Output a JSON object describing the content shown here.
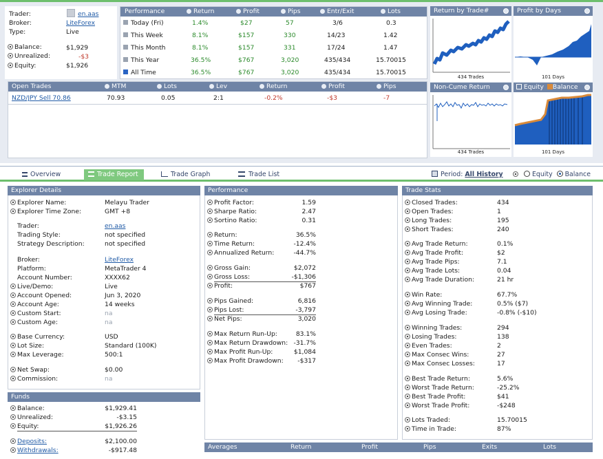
{
  "account": {
    "trader_label": "Trader:",
    "trader": "en.aas",
    "broker_label": "Broker:",
    "broker": "LiteForex",
    "type_label": "Type:",
    "type": "Live",
    "balance_label": "Balance:",
    "balance": "$1,929",
    "unrealized_label": "Unrealized:",
    "unrealized": "-$3",
    "equity_label": "Equity:",
    "equity": "$1,926"
  },
  "performance_table": {
    "headers": [
      "Performance",
      "Return",
      "Profit",
      "Pips",
      "Entr/Exit",
      "Lots"
    ],
    "rows": [
      {
        "period": "Today (Fri)",
        "return": "1.4%",
        "profit": "$27",
        "pips": "57",
        "entr_exit": "3/6",
        "lots": "0.3"
      },
      {
        "period": "This Week",
        "return": "8.1%",
        "profit": "$157",
        "pips": "330",
        "entr_exit": "14/23",
        "lots": "1.42"
      },
      {
        "period": "This Month",
        "return": "8.1%",
        "profit": "$157",
        "pips": "331",
        "entr_exit": "17/24",
        "lots": "1.47"
      },
      {
        "period": "This Year",
        "return": "36.5%",
        "profit": "$767",
        "pips": "3,020",
        "entr_exit": "435/434",
        "lots": "15.70015"
      },
      {
        "period": "All Time",
        "return": "36.5%",
        "profit": "$767",
        "pips": "3,020",
        "entr_exit": "435/434",
        "lots": "15.70015"
      }
    ]
  },
  "open_trades": {
    "headers": [
      "Open Trades",
      "MTM",
      "Lots",
      "Lev",
      "Return",
      "Profit",
      "Pips"
    ],
    "rows": [
      {
        "trade": "NZD/JPY Sell 70.86",
        "mtm": "70.93",
        "lots": "0.05",
        "lev": "2:1",
        "return": "-0.2%",
        "profit": "-$3",
        "pips": "-7"
      }
    ]
  },
  "mini_charts": {
    "return_by_trade": {
      "title": "Return by Trade#",
      "caption": "434 Trades"
    },
    "profit_by_days": {
      "title": "Profit by Days",
      "caption": "101 Days"
    },
    "non_cume_return": {
      "title": "Non-Cume Return",
      "caption": "434 Trades"
    },
    "equity_balance": {
      "equity_label": "Equity",
      "balance_label": "Balance",
      "caption": "101 Days"
    }
  },
  "tabs": {
    "overview": "Overview",
    "trade_report": "Trade Report",
    "trade_graph": "Trade Graph",
    "trade_list": "Trade List",
    "period_label": "Period:",
    "period_value": "All History",
    "equity": "Equity",
    "balance": "Balance"
  },
  "explorer": {
    "title": "Explorer Details",
    "items": [
      {
        "label": "Explorer Name:",
        "value": "Melayu Trader"
      },
      {
        "label": "Explorer Time Zone:",
        "value": "GMT +8"
      },
      {
        "label": "Trader:",
        "value": "en.aas"
      },
      {
        "label": "Trading Style:",
        "value": "not specified"
      },
      {
        "label": "Strategy Description:",
        "value": "not specified"
      },
      {
        "label": "Broker:",
        "value": "LiteForex"
      },
      {
        "label": "Platform:",
        "value": "MetaTrader 4"
      },
      {
        "label": "Account Number:",
        "value": "XXXX62"
      },
      {
        "label": "Live/Demo:",
        "value": "Live"
      },
      {
        "label": "Account Opened:",
        "value": "Jun 3, 2020"
      },
      {
        "label": "Account Age:",
        "value": "14 weeks"
      },
      {
        "label": "Custom Start:",
        "value": "na"
      },
      {
        "label": "Custom Age:",
        "value": "na"
      },
      {
        "label": "Base Currency:",
        "value": "USD"
      },
      {
        "label": "Lot Size:",
        "value": "Standard (100K)"
      },
      {
        "label": "Max Leverage:",
        "value": "500:1"
      },
      {
        "label": "Net Swap:",
        "value": "$0.00"
      },
      {
        "label": "Commission:",
        "value": "na"
      }
    ]
  },
  "funds": {
    "title": "Funds",
    "items": [
      {
        "label": "Balance:",
        "value": "$1,929.41"
      },
      {
        "label": "Unrealized:",
        "value": "-$3.15"
      },
      {
        "label": "Equity:",
        "value": "$1,926.26"
      },
      {
        "label": "Deposits:",
        "value": "$2,100.00"
      },
      {
        "label": "Withdrawals:",
        "value": "-$917.48"
      }
    ]
  },
  "performance": {
    "title": "Performance",
    "items": [
      {
        "label": "Profit Factor:",
        "value": "1.59"
      },
      {
        "label": "Sharpe Ratio:",
        "value": "2.47"
      },
      {
        "label": "Sortino Ratio:",
        "value": "0.31"
      },
      {
        "label": "Return:",
        "value": "36.5%"
      },
      {
        "label": "Time Return:",
        "value": "-12.4%"
      },
      {
        "label": "Annualized Return:",
        "value": "-44.7%"
      },
      {
        "label": "Gross Gain:",
        "value": "$2,072"
      },
      {
        "label": "Gross Loss:",
        "value": "-$1,306"
      },
      {
        "label": "Profit:",
        "value": "$767"
      },
      {
        "label": "Pips Gained:",
        "value": "6,816"
      },
      {
        "label": "Pips Lost:",
        "value": "-3,797"
      },
      {
        "label": "Net Pips:",
        "value": "3,020"
      },
      {
        "label": "Max Return Run-Up:",
        "value": "83.1%"
      },
      {
        "label": "Max Return Drawdown:",
        "value": "-31.7%"
      },
      {
        "label": "Max Profit Run-Up:",
        "value": "$1,084"
      },
      {
        "label": "Max Profit Drawdown:",
        "value": "-$317"
      }
    ]
  },
  "trade_stats": {
    "title": "Trade Stats",
    "items": [
      {
        "label": "Closed Trades:",
        "value": "434"
      },
      {
        "label": "Open Trades:",
        "value": "1"
      },
      {
        "label": "Long Trades:",
        "value": "195"
      },
      {
        "label": "Short Trades:",
        "value": "240"
      },
      {
        "label": "Avg Trade Return:",
        "value": "0.1%"
      },
      {
        "label": "Avg Trade Profit:",
        "value": "$2"
      },
      {
        "label": "Avg Trade Pips:",
        "value": "7.1"
      },
      {
        "label": "Avg Trade Lots:",
        "value": "0.04"
      },
      {
        "label": "Avg Trade Duration:",
        "value": "21 hr"
      },
      {
        "label": "Win Rate:",
        "value": "67.7%"
      },
      {
        "label": "Avg Winning Trade:",
        "value": "0.5% ($7)"
      },
      {
        "label": "Avg Losing Trade:",
        "value": "-0.8% (-$10)"
      },
      {
        "label": "Winning Trades:",
        "value": "294"
      },
      {
        "label": "Losing Trades:",
        "value": "138"
      },
      {
        "label": "Even Trades:",
        "value": "2"
      },
      {
        "label": "Max Consec Wins:",
        "value": "27"
      },
      {
        "label": "Max Consec Losses:",
        "value": "17"
      },
      {
        "label": "Best Trade Return:",
        "value": "5.6%"
      },
      {
        "label": "Worst Trade Return:",
        "value": "-25.2%"
      },
      {
        "label": "Best Trade Profit:",
        "value": "$41"
      },
      {
        "label": "Worst Trade Profit:",
        "value": "-$248"
      },
      {
        "label": "Lots Traded:",
        "value": "15.70015"
      },
      {
        "label": "Time in Trade:",
        "value": "87%"
      }
    ]
  },
  "averages": {
    "headers": [
      "Averages",
      "Return",
      "Profit",
      "Pips",
      "Exits",
      "Lots"
    ]
  },
  "colors": {
    "header": "#6f84a6",
    "accent_green": "#6dbf6d",
    "positive": "#2b8a2b",
    "negative": "#c0392b",
    "chart_blue": "#1f5fbf",
    "balance_orange": "#d98a3a"
  }
}
